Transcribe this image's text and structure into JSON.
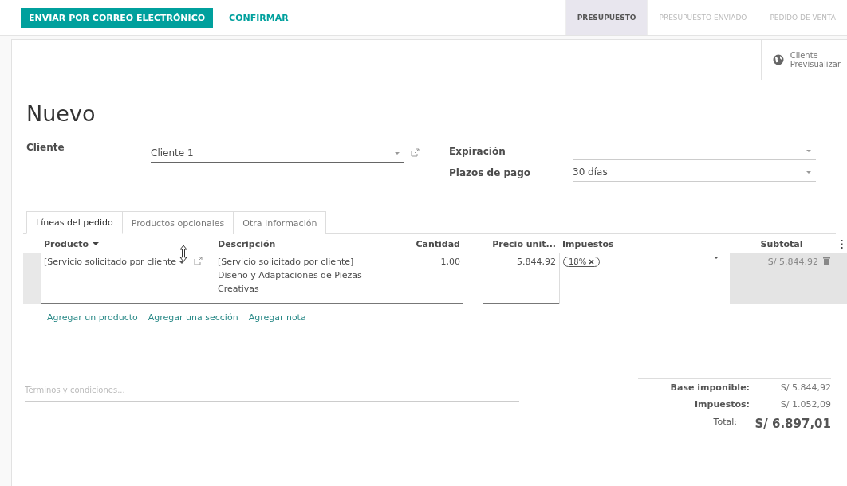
{
  "actions": [
    {
      "label": "ENVIAR POR CORREO ELECTRÓNICO",
      "kind": "primary"
    },
    {
      "label": "CONFIRMAR",
      "kind": "link"
    }
  ],
  "steps": [
    {
      "label": "PRESUPUESTO",
      "selected": true
    },
    {
      "label": "PRESUPUESTO ENVIADO",
      "selected": false
    },
    {
      "label": "PEDIDO DE VENTA",
      "selected": false
    }
  ],
  "preview_button": {
    "line_1": "Cliente",
    "line_2": "Previsualizar"
  },
  "title": "Nuevo",
  "customer": {
    "label": "Cliente",
    "value": "Cliente 1"
  },
  "right_fields": [
    {
      "label": "Expiración"
    },
    {
      "label": "Plazos de pago",
      "value": "30 días"
    }
  ],
  "tabs": [
    {
      "label": "Líneas del pedido",
      "selected": true
    },
    {
      "label": "Productos opcionales",
      "selected": false
    },
    {
      "label": "Otra Información",
      "selected": false
    }
  ],
  "table": {
    "columns": [
      "Producto",
      "Descripción",
      "Cantidad",
      "Precio unit...",
      "Impuestos",
      "Subtotal"
    ],
    "rows": [
      {
        "product": "[Servicio solicitado por cliente",
        "description": "[Servicio solicitado por cliente] Diseño y Adaptaciones de Piezas Creativas",
        "quantity": "1,00",
        "unit_price": "5.844,92",
        "taxes": [
          "18%"
        ],
        "subtotal": "S/ 5.844,92"
      }
    ]
  },
  "add_links": [
    "Agregar un producto",
    "Agregar una sección",
    "Agregar nota"
  ],
  "terms": {
    "placeholder": "Términos y condiciones..."
  },
  "totals": [
    {
      "label": "Base imponible:",
      "value": "S/ 5.844,92",
      "kind": "line"
    },
    {
      "label": "Impuestos:",
      "value": "S/ 1.052,09",
      "kind": "line"
    },
    {
      "label": "Total:",
      "value": "S/ 6.897,01",
      "kind": "total"
    }
  ]
}
